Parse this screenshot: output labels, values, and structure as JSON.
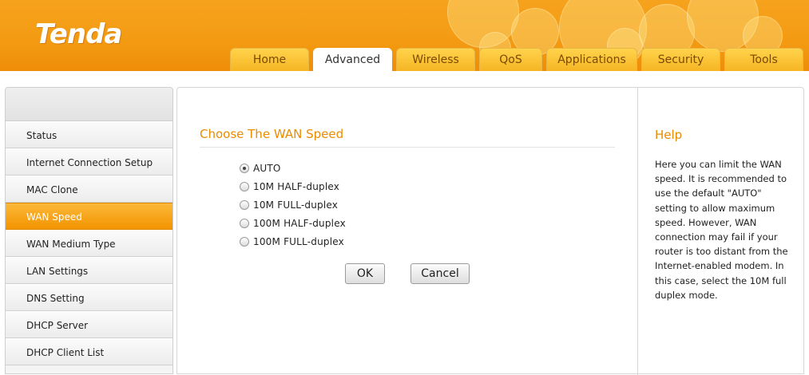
{
  "brand": {
    "logo_text": "Tenda"
  },
  "tabs": [
    {
      "label": "Home"
    },
    {
      "label": "Advanced"
    },
    {
      "label": "Wireless"
    },
    {
      "label": "QoS"
    },
    {
      "label": "Applications"
    },
    {
      "label": "Security"
    },
    {
      "label": "Tools"
    }
  ],
  "active_tab": "Advanced",
  "sidebar": {
    "items": [
      {
        "label": "Status"
      },
      {
        "label": "Internet Connection Setup"
      },
      {
        "label": "MAC Clone"
      },
      {
        "label": "WAN Speed"
      },
      {
        "label": "WAN Medium Type"
      },
      {
        "label": "LAN Settings"
      },
      {
        "label": "DNS Setting"
      },
      {
        "label": "DHCP Server"
      },
      {
        "label": "DHCP Client List"
      }
    ],
    "active_item": "WAN Speed"
  },
  "main": {
    "section_title": "Choose The WAN Speed",
    "options": [
      {
        "label": "AUTO",
        "checked": true
      },
      {
        "label": "10M HALF-duplex",
        "checked": false
      },
      {
        "label": "10M FULL-duplex",
        "checked": false
      },
      {
        "label": "100M HALF-duplex",
        "checked": false
      },
      {
        "label": "100M FULL-duplex",
        "checked": false
      }
    ],
    "ok_label": "OK",
    "cancel_label": "Cancel"
  },
  "help": {
    "title": "Help",
    "text": "Here you can limit the WAN speed. It is recommended to use the default \"AUTO\" setting to allow maximum speed. However, WAN connection may fail if your router is too distant from the Internet-enabled modem. In this case, select the 10M full duplex mode."
  },
  "colors": {
    "brand_orange": "#f39a12",
    "accent_text": "#e98c00"
  }
}
